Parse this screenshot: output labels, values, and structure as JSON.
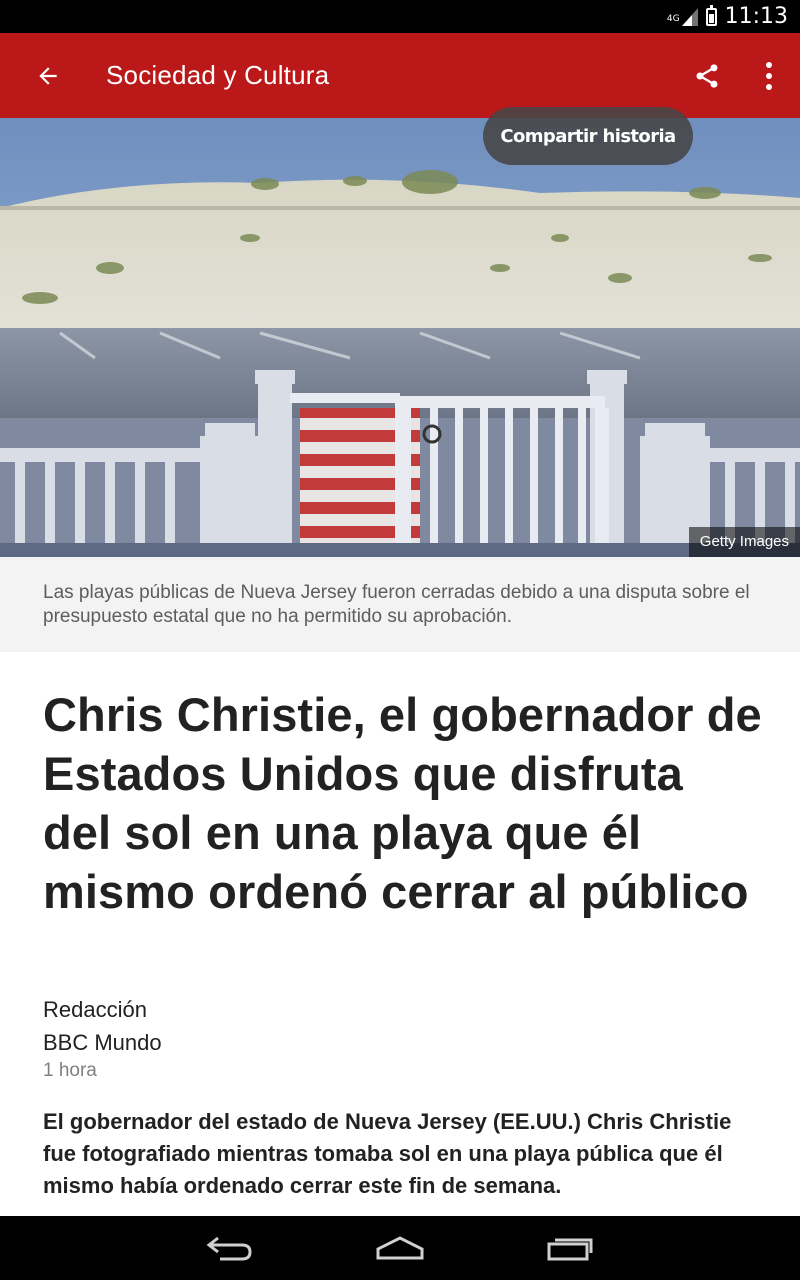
{
  "status_bar": {
    "network_label": "4G",
    "time": "11:13"
  },
  "app_bar": {
    "title": "Sociedad y Cultura",
    "background_color": "#bb1919",
    "back_icon": "arrow-back-icon",
    "share_icon": "share-icon",
    "menu_icon": "more-vert-icon"
  },
  "tooltip": {
    "text": "Compartir historia"
  },
  "hero": {
    "credit": "Getty Images"
  },
  "caption": "Las playas públicas de Nueva Jersey fueron cerradas debido a una disputa sobre el presupuesto estatal que no ha permitido su aprobación.",
  "article": {
    "headline": "Chris Christie, el gobernador de Estados Unidos que disfruta del sol en una playa que él mismo ordenó cerrar al público",
    "byline_name": "Redacción",
    "byline_outlet": "BBC Mundo",
    "time_ago": "1 hora",
    "lead": "El gobernador del estado de Nueva Jersey (EE.UU.) Chris Christie fue fotografiado mientras tomaba sol en una playa pública que él mismo había ordenado cerrar este fin de semana."
  },
  "nav_bar": {
    "back_icon": "nav-back-icon",
    "home_icon": "nav-home-icon",
    "recents_icon": "nav-recents-icon"
  }
}
